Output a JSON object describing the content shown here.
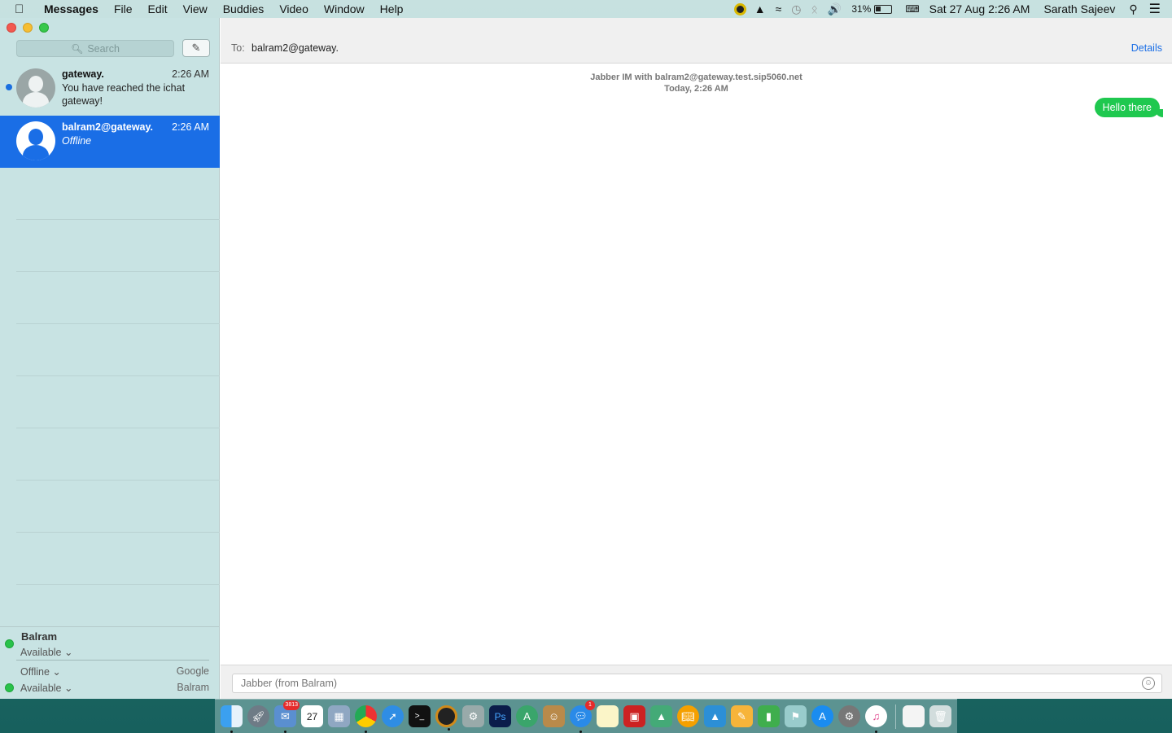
{
  "menubar": {
    "app_name": "Messages",
    "menus": [
      "File",
      "Edit",
      "View",
      "Buddies",
      "Video",
      "Window",
      "Help"
    ],
    "battery": "31%",
    "datetime": "Sat 27 Aug  2:26 AM",
    "user": "Sarath Sajeev"
  },
  "sidebar": {
    "search_placeholder": "Search",
    "conversations": [
      {
        "name": "gateway.",
        "time": "2:26 AM",
        "preview": "You have reached the ichat gateway!",
        "unread": true
      },
      {
        "name": "balram2@gateway.",
        "time": "2:26 AM",
        "preview": "Offline",
        "selected": true
      }
    ],
    "accounts": {
      "name": "Balram",
      "status": "Available",
      "rows": [
        {
          "status": "Offline",
          "service": "Google"
        },
        {
          "status": "Available",
          "service": "Balram"
        }
      ]
    }
  },
  "chat": {
    "to_label": "To:",
    "to_value": "balram2@gateway.",
    "details_label": "Details",
    "info_line1": "Jabber IM with balram2@gateway.test.sip5060.net",
    "info_line2": "Today, 2:26 AM",
    "messages": [
      {
        "text": "Hello there",
        "from": "me"
      }
    ],
    "input_placeholder": "Jabber (from Balram)"
  },
  "dock": {
    "mail_badge": "3813",
    "calendar_day": "27",
    "messages_badge": "1",
    "accent": "#1a6ee6",
    "bubble_color": "#1fc84f"
  }
}
